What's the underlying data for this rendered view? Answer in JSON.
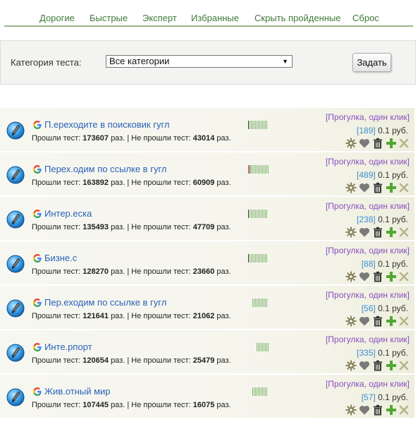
{
  "nav": {
    "items": [
      "Дорогие",
      "Быстрые",
      "Эксперт",
      "Избранные",
      "Скрыть пройденные",
      "Сброс"
    ]
  },
  "filter": {
    "label": "Категория теста:",
    "selected": "Все категории",
    "submit": "Задать"
  },
  "labels": {
    "passed": "Прошли тест:",
    "failed": "Не прошли тест:",
    "times": "раз.",
    "separator": "|",
    "currency": "руб."
  },
  "tasks": [
    {
      "title": "П.ереходите в поисковик гугл",
      "passed": "173607",
      "failed": "43014",
      "type": "[Прогулка, один клик]",
      "count": "[189]",
      "price": "0.1",
      "bar": {
        "red": 0,
        "dark": 1,
        "green": 13
      }
    },
    {
      "title": "Перех.одим по ссылке в гугл",
      "passed": "163892",
      "failed": "60909",
      "type": "[Прогулка, один клик]",
      "count": "[489]",
      "price": "0.1",
      "bar": {
        "red": 1,
        "dark": 1,
        "green": 13
      }
    },
    {
      "title": "Интер.еска",
      "passed": "135493",
      "failed": "47709",
      "type": "[Прогулка, один клик]",
      "count": "[238]",
      "price": "0.1",
      "bar": {
        "red": 0,
        "dark": 1,
        "green": 13
      }
    },
    {
      "title": "Бизне.с",
      "passed": "128270",
      "failed": "23660",
      "type": "[Прогулка, один клик]",
      "count": "[88]",
      "price": "0.1",
      "bar": {
        "red": 0,
        "dark": 1,
        "green": 13
      }
    },
    {
      "title": "Пер.еходим по ссылке в гугл",
      "passed": "121641",
      "failed": "21062",
      "type": "[Прогулка, один клик]",
      "count": "[56]",
      "price": "0.1",
      "bar": {
        "red": 0,
        "dark": 0,
        "green": 11
      }
    },
    {
      "title": "Инте.рпорт",
      "passed": "120654",
      "failed": "25479",
      "type": "[Прогулка, один клик]",
      "count": "[335]",
      "price": "0.1",
      "bar": {
        "red": 0,
        "dark": 0,
        "green": 9
      }
    },
    {
      "title": "Жив.отный мир",
      "passed": "107445",
      "failed": "16075",
      "type": "[Прогулка, один клик]",
      "count": "[57]",
      "price": "0.1",
      "bar": {
        "red": 0,
        "dark": 0,
        "green": 11
      }
    }
  ]
}
